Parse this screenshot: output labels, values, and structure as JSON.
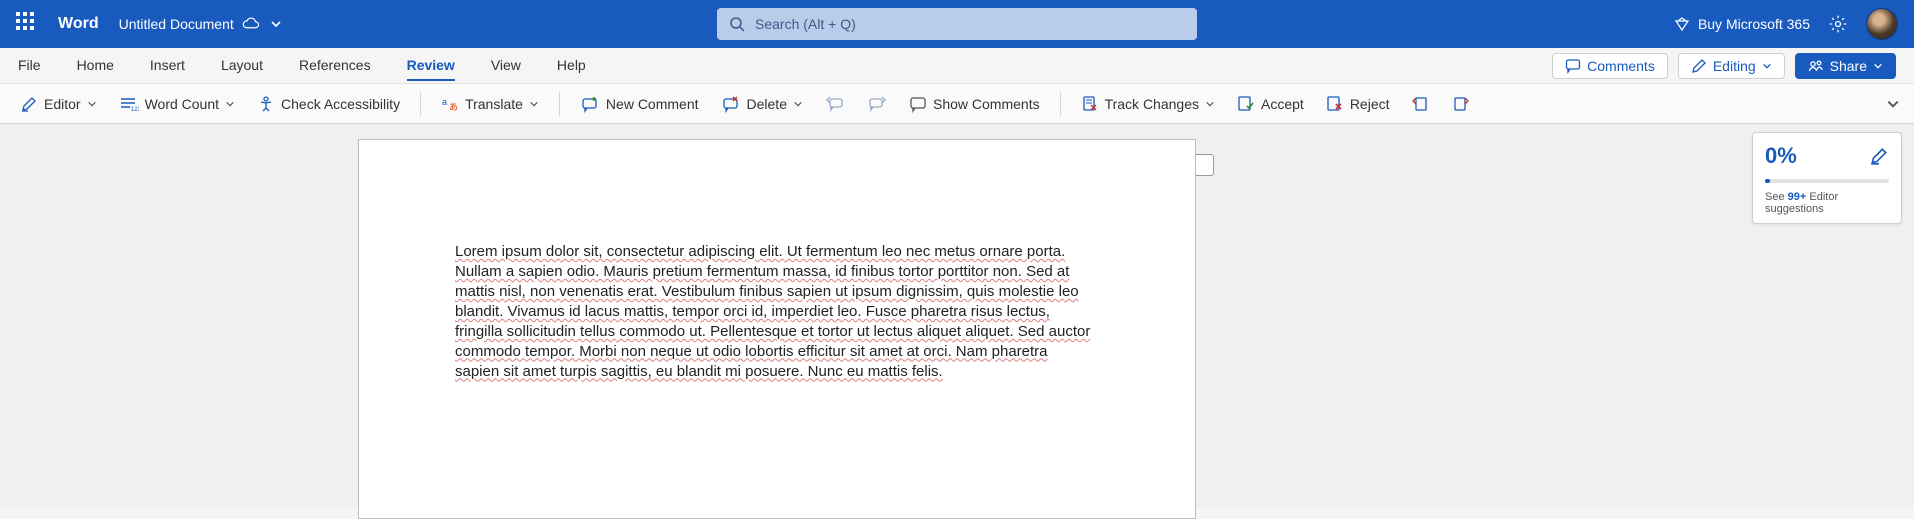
{
  "title_bar": {
    "app_name": "Word",
    "doc_title": "Untitled Document",
    "search_placeholder": "Search (Alt + Q)",
    "buy_label": "Buy Microsoft 365"
  },
  "menu": {
    "tabs": [
      "File",
      "Home",
      "Insert",
      "Layout",
      "References",
      "Review",
      "View",
      "Help"
    ],
    "active_index": 5,
    "comments_label": "Comments",
    "editing_label": "Editing",
    "share_label": "Share"
  },
  "ribbon": {
    "editor": "Editor",
    "word_count": "Word Count",
    "check_accessibility": "Check Accessibility",
    "translate": "Translate",
    "new_comment": "New Comment",
    "delete": "Delete",
    "show_comments": "Show Comments",
    "track_changes": "Track Changes",
    "accept": "Accept",
    "reject": "Reject"
  },
  "editor_card": {
    "percent": "0%",
    "see_prefix": "See ",
    "count": "99+",
    "see_suffix": " Editor suggestions"
  },
  "document": {
    "paragraph": "Lorem ipsum dolor sit, consectetur adipiscing elit. Ut fermentum leo nec metus ornare porta. Nullam a sapien odio. Mauris pretium fermentum massa, id finibus tortor porttitor non. Sed at mattis nisl, non venenatis erat. Vestibulum finibus sapien ut ipsum dignissim, quis molestie leo blandit. Vivamus id lacus mattis, tempor orci id, imperdiet leo. Fusce pharetra risus lectus, fringilla sollicitudin tellus commodo ut. Pellentesque et tortor ut lectus aliquet aliquet. Sed auctor commodo tempor. Morbi non neque ut odio lobortis efficitur sit amet at orci. Nam pharetra sapien sit amet turpis sagittis, eu blandit mi posuere. Nunc eu mattis felis."
  },
  "colors": {
    "brand": "#185abd",
    "search_bg": "#b9cdeb"
  }
}
